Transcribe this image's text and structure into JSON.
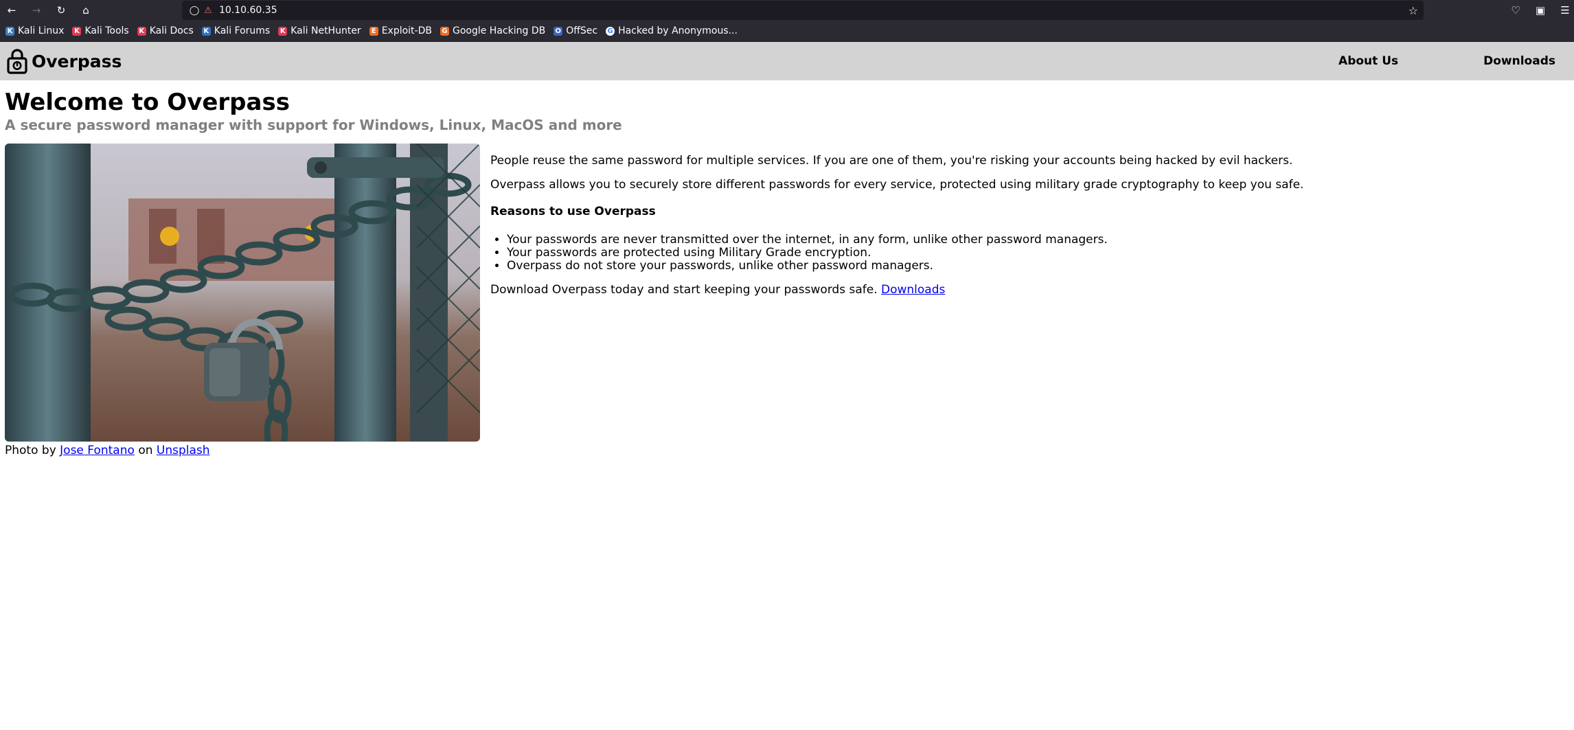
{
  "browser": {
    "url": "10.10.60.35",
    "bookmarks": [
      {
        "label": "Kali Linux",
        "color": "#3b82c4",
        "glyph": "K"
      },
      {
        "label": "Kali Tools",
        "color": "#e23b53",
        "glyph": "K"
      },
      {
        "label": "Kali Docs",
        "color": "#e23b53",
        "glyph": "K"
      },
      {
        "label": "Kali Forums",
        "color": "#2e74c9",
        "glyph": "K"
      },
      {
        "label": "Kali NetHunter",
        "color": "#e23b53",
        "glyph": "K"
      },
      {
        "label": "Exploit-DB",
        "color": "#f26b21",
        "glyph": "E"
      },
      {
        "label": "Google Hacking DB",
        "color": "#f26b21",
        "glyph": "G"
      },
      {
        "label": "OffSec",
        "color": "#3f64c8",
        "glyph": "O"
      },
      {
        "label": "Hacked by Anonymous...",
        "color": "#ffffff",
        "glyph": "G"
      }
    ]
  },
  "site": {
    "brand": "Overpass",
    "nav": {
      "about": "About Us",
      "downloads": "Downloads"
    },
    "title": "Welcome to Overpass",
    "subtitle": "A secure password manager with support for Windows, Linux, MacOS and more",
    "caption": {
      "prefix": "Photo by",
      "author": "Jose Fontano",
      "middle": "on",
      "source": "Unsplash"
    },
    "intro_1": "People reuse the same password for multiple services. If you are one of them, you're risking your accounts being hacked by evil hackers.",
    "intro_2": "Overpass allows you to securely store different passwords for every service, protected using military grade cryptography to keep you safe.",
    "reasons_heading": "Reasons to use Overpass",
    "reasons": [
      "Your passwords are never transmitted over the internet, in any form, unlike other password managers.",
      "Your passwords are protected using Military Grade encryption.",
      "Overpass do not store your passwords, unlike other password managers."
    ],
    "cta_text": "Download Overpass today and start keeping your passwords safe.",
    "cta_link": "Downloads"
  }
}
